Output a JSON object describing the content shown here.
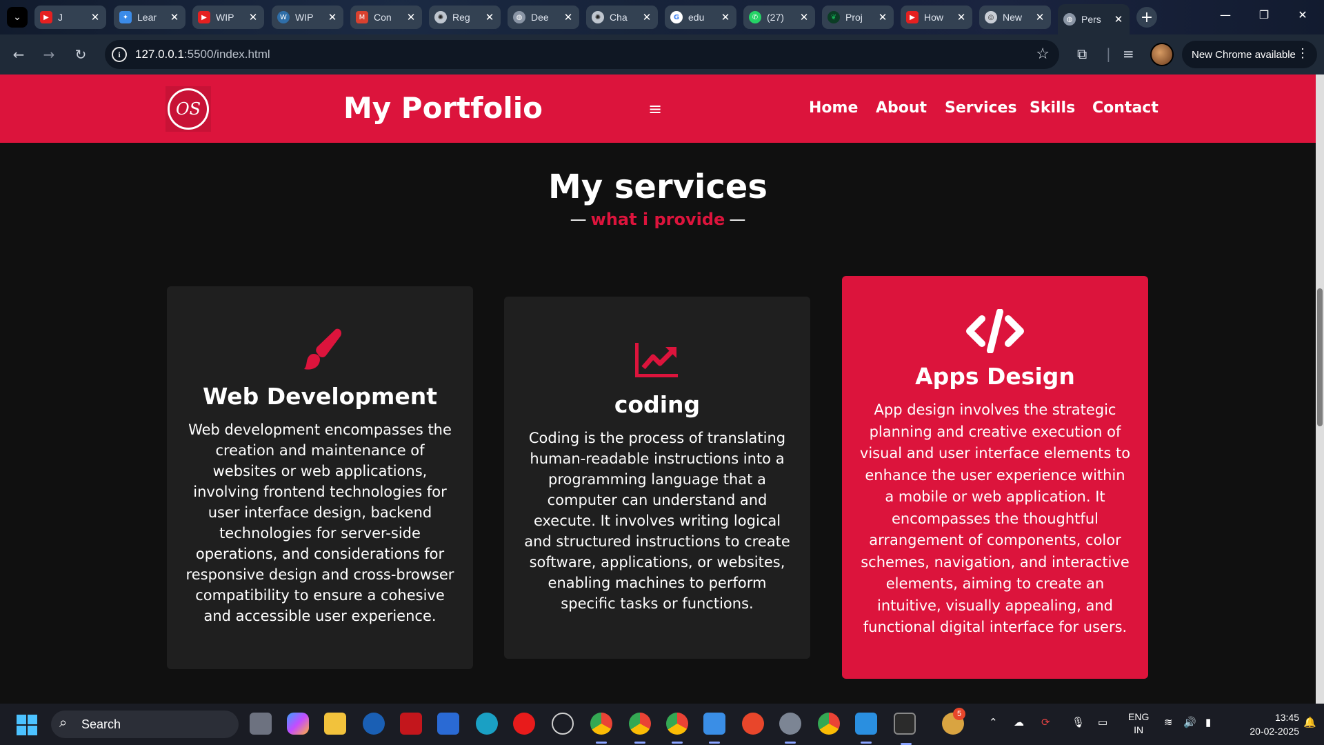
{
  "browser": {
    "tabs": [
      {
        "title": "J",
        "favicon": "youtube-icon",
        "color": "#e52020"
      },
      {
        "title": "Lear",
        "favicon": "butterfly-icon",
        "color": "#3b8be8"
      },
      {
        "title": "WIP",
        "favicon": "youtube-icon",
        "color": "#e52020"
      },
      {
        "title": "WIP",
        "favicon": "wordpress-icon",
        "color": "#2f6ea8"
      },
      {
        "title": "Con",
        "favicon": "gmail-icon",
        "color": "#d9412f"
      },
      {
        "title": "Reg",
        "favicon": "openai-icon",
        "color": "#bfc6cf"
      },
      {
        "title": "Dee",
        "favicon": "globe-icon",
        "color": "#8a95a5"
      },
      {
        "title": "Cha",
        "favicon": "openai-icon",
        "color": "#bfc6cf"
      },
      {
        "title": "edu",
        "favicon": "google-icon",
        "color": "#4285f4"
      },
      {
        "title": "(27)",
        "favicon": "whatsapp-icon",
        "color": "#25d366"
      },
      {
        "title": "Proj",
        "favicon": "mongodb-icon",
        "color": "#13aa52"
      },
      {
        "title": "How",
        "favicon": "youtube-icon",
        "color": "#e52020"
      },
      {
        "title": "New",
        "favicon": "chrome-icon",
        "color": "#c9ced6"
      },
      {
        "title": "Pers",
        "favicon": "globe-icon",
        "color": "#8a95a5"
      }
    ],
    "url_host": "127.0.0.1",
    "url_path": ":5500/index.html",
    "update_label": "New Chrome available"
  },
  "site": {
    "logo_text": "OS",
    "brand": "My Portfolio",
    "nav": [
      "Home",
      "About",
      "Services",
      "Skills",
      "Contact"
    ],
    "accent_color": "#dc143c"
  },
  "services": {
    "title": "My services",
    "dash_left": "—",
    "subtitle": "what i provide",
    "dash_right": "—",
    "cards": [
      {
        "icon": "paintbrush-icon",
        "title": "Web Development",
        "text": "Web development encompasses the creation and maintenance of websites or web applications, involving frontend technologies for user interface design, backend technologies for server-side operations, and considerations for responsive design and cross-browser compatibility to ensure a cohesive and accessible user experience."
      },
      {
        "icon": "chart-line-icon",
        "title": "coding",
        "text": "Coding is the process of translating human-readable instructions into a programming language that a computer can understand and execute. It involves writing logical and structured instructions to create software, applications, or websites, enabling machines to perform specific tasks or functions."
      },
      {
        "icon": "code-icon",
        "title": "Apps Design",
        "text": "App design involves the strategic planning and creative execution of visual and user interface elements to enhance the user experience within a mobile or web application. It encompasses the thoughtful arrangement of components, color schemes, navigation, and interactive elements, aiming to create an intuitive, visually appealing, and functional digital interface for users."
      }
    ]
  },
  "taskbar": {
    "search_label": "Search",
    "store_badge": "5",
    "language": "ENG",
    "region": "IN",
    "time": "13:45",
    "date": "20-02-2025"
  }
}
